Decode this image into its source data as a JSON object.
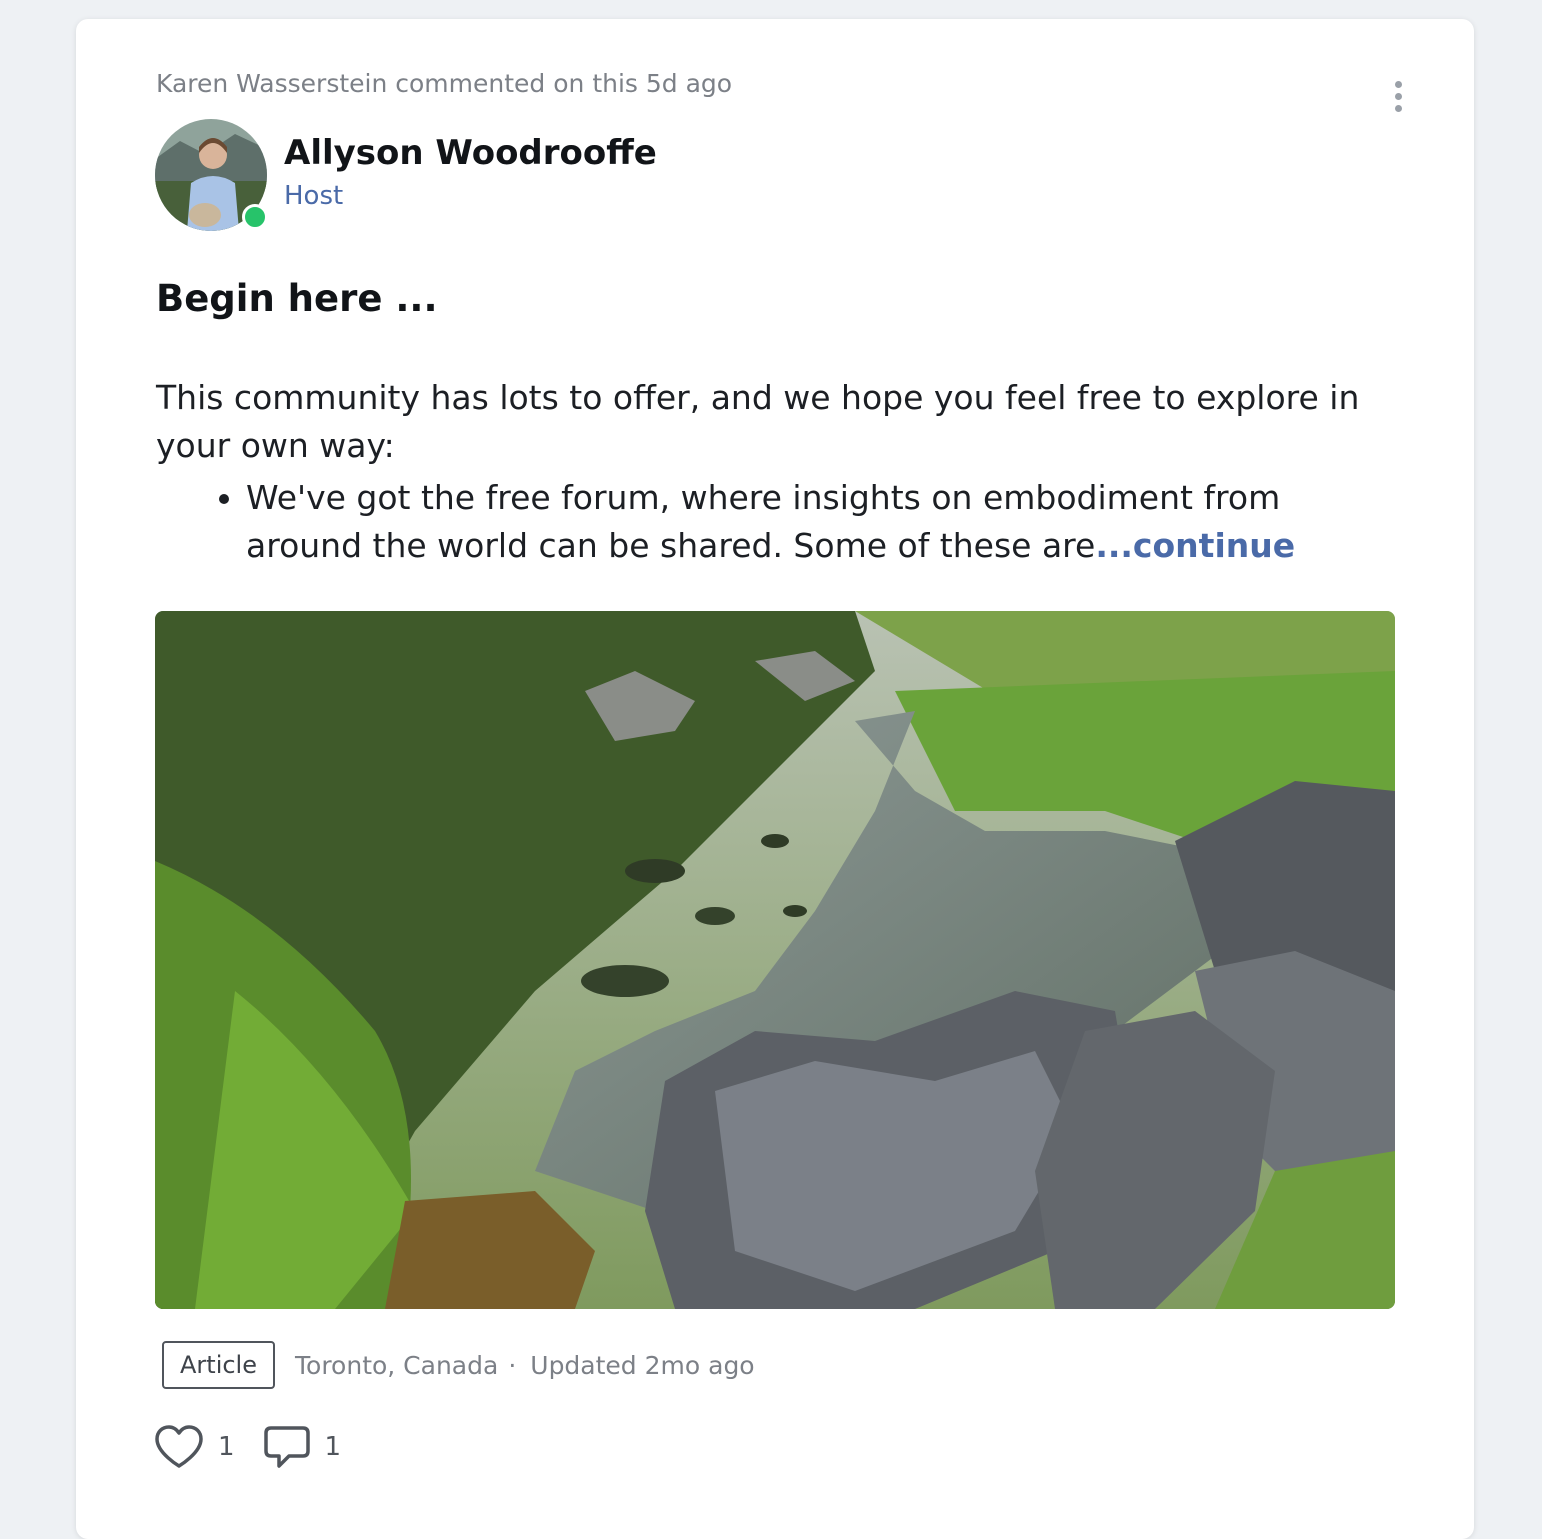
{
  "post": {
    "activity": "Karen Wasserstein commented on this 5d ago",
    "author": {
      "name": "Allyson Woodrooffe",
      "role": "Host"
    },
    "title": "Begin here ...",
    "body_intro": "This community has lots to offer, and we hope you feel free to explore in your own way:",
    "bullet_text": "We've got the free forum, where insights on embodiment from around the world can be shared. Some of these are",
    "continue_label": "...continue",
    "tag": "Article",
    "location": "Toronto, Canada",
    "separator": "·",
    "updated": "Updated 2mo ago",
    "likes": "1",
    "comments": "1"
  },
  "colors": {
    "accent": "#4a6aa8",
    "online": "#27c36a",
    "muted_text": "#7c8087"
  },
  "icons": {
    "more": "more-vertical-icon",
    "like": "heart-icon",
    "comment": "comment-icon"
  }
}
